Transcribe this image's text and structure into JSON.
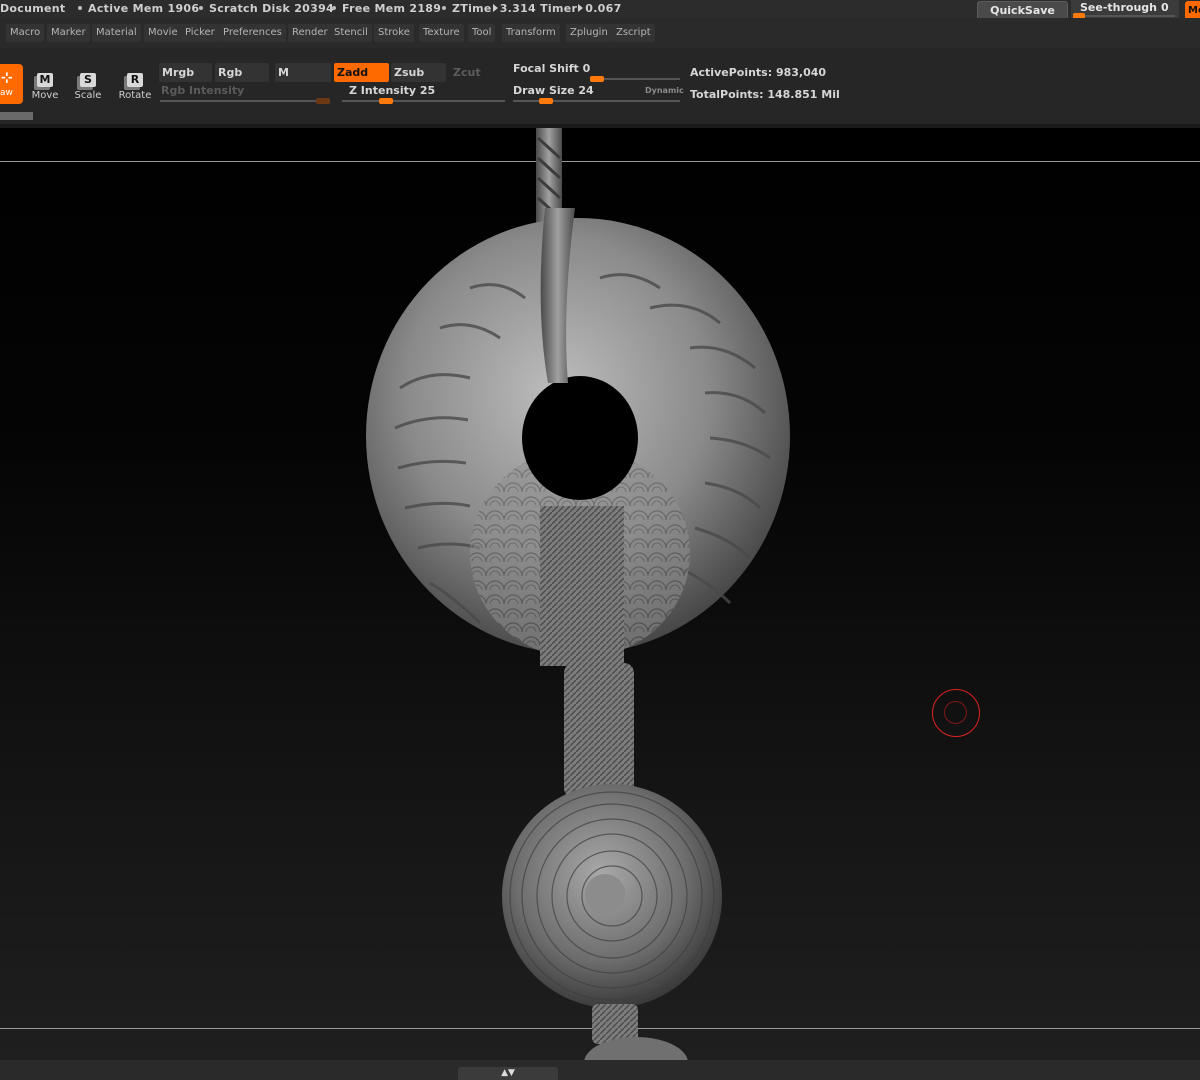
{
  "status": {
    "document": "Document",
    "active_mem": "Active Mem 1906",
    "scratch_disk": "Scratch Disk 20394",
    "free_mem": "Free Mem 2189",
    "ztime_label": "ZTime",
    "ztime_value": "3.314",
    "timer_label": "Timer",
    "timer_value": "0.067",
    "quicksave": "QuickSave",
    "see_through_label": "See-through",
    "see_through_value": "0",
    "corner_label": "Me",
    "accent_color": "#ff6a00"
  },
  "menu": {
    "items": [
      "Macro",
      "Marker",
      "Material",
      "Movie",
      "Picker",
      "Preferences",
      "Render",
      "Stencil",
      "Stroke",
      "Texture",
      "Tool",
      "Transform",
      "Zplugin",
      "Zscript"
    ]
  },
  "toolbar": {
    "draw_label": "aw",
    "move": {
      "icon": "M",
      "label": "Move"
    },
    "scale": {
      "icon": "S",
      "label": "Scale"
    },
    "rotate": {
      "icon": "R",
      "label": "Rotate"
    },
    "mrgb": "Mrgb",
    "rgb": "Rgb",
    "m": "M",
    "zadd": "Zadd",
    "zsub": "Zsub",
    "zcut": "Zcut",
    "rgb_intensity_label": "Rgb Intensity",
    "z_intensity_label": "Z Intensity",
    "z_intensity_value": "25",
    "focal_shift_label": "Focal Shift",
    "focal_shift_value": "0",
    "draw_size_label": "Draw Size",
    "draw_size_value": "24",
    "dynamic": "Dynamic",
    "active_points_label": "ActivePoints:",
    "active_points_value": "983,040",
    "total_points_label": "TotalPoints:",
    "total_points_value": "148.851 Mil"
  },
  "sliders": {
    "rgb_intensity_level": 1.0,
    "z_intensity_level": 0.25,
    "focal_shift_level": 0.0,
    "draw_size_level": 0.17
  }
}
